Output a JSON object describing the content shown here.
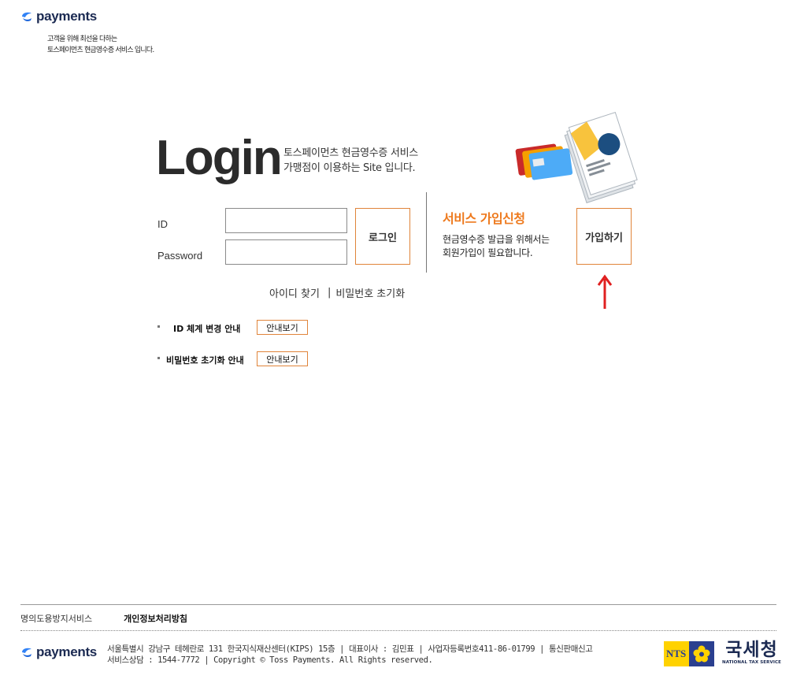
{
  "header": {
    "logo_text": "payments",
    "tagline_line1": "고객을 위해 최선을 다하는",
    "tagline_line2": "토스페이먼츠 현금영수증 서비스 입니다."
  },
  "login": {
    "title": "Login",
    "desc_line1": "토스페이먼츠 현금영수증 서비스",
    "desc_line2": "가맹점이 이용하는 Site 입니다.",
    "id_label": "ID",
    "password_label": "Password",
    "id_value": "",
    "password_value": "",
    "login_button": "로그인"
  },
  "signup": {
    "title": "서비스 가입신청",
    "desc_line1": "현금영수증 발급을 위해서는",
    "desc_line2": "회원가입이 필요합니다.",
    "button": "가입하기",
    "arrow_color": "#e02020"
  },
  "find": {
    "find_id": "아이디 찾기",
    "separator": "|",
    "reset_password": "비밀번호 초기화"
  },
  "notices": [
    {
      "label": "ID 체계 변경 안내",
      "button": "안내보기"
    },
    {
      "label": "비밀번호 초기화 안내",
      "button": "안내보기"
    }
  ],
  "footer": {
    "link_spam": "명의도용방지서비스",
    "link_privacy": "개인정보처리방침",
    "logo_text": "payments",
    "info_line1": "서울특별시 강남구 테헤란로 131 한국지식재산센터(KIPS) 15층 | 대표이사 : 김민표 | 사업자등록번호411-86-01799 | 통신판매신고",
    "info_line2": "서비스상담 : 1544-7772 | Copyright © Toss Payments. All Rights reserved.",
    "nts_abbr": "NTS",
    "nts_korean": "국세청",
    "nts_english": "NATIONAL TAX SERVICE"
  },
  "colors": {
    "brand_blue": "#3182f6",
    "accent_orange": "#ee7a1e",
    "button_border": "#e0843a"
  }
}
